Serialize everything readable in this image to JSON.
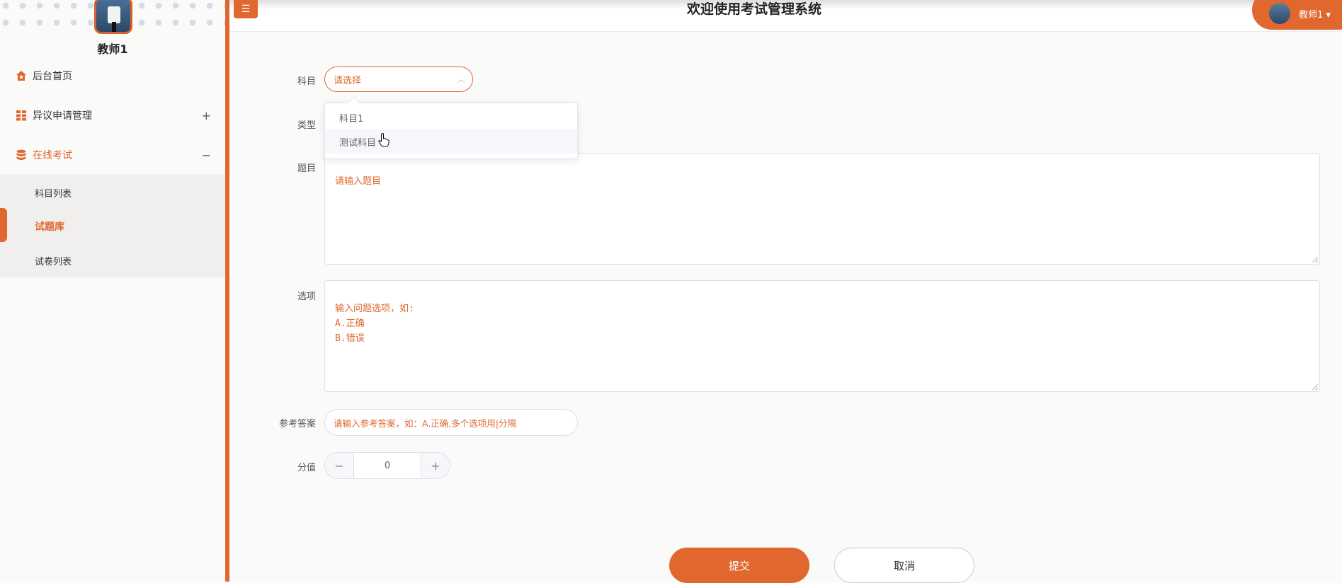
{
  "app": {
    "title": "欢迎使用考试管理系统",
    "user": "教师1",
    "user_menu": "教师1 ▾"
  },
  "sidebar": {
    "username": "教师1",
    "items": [
      {
        "label": "后台首页",
        "icon": "home-icon"
      },
      {
        "label": "异议申请管理",
        "icon": "grid-icon",
        "toggle": "+"
      },
      {
        "label": "在线考试",
        "icon": "database-icon",
        "toggle": "−"
      }
    ],
    "submenu": [
      {
        "label": "科目列表"
      },
      {
        "label": "试题库"
      },
      {
        "label": "试卷列表"
      }
    ]
  },
  "form": {
    "labels": {
      "subject": "科目",
      "type": "类型",
      "question": "题目",
      "options": "选项",
      "answer": "参考答案",
      "score": "分值"
    },
    "subject_placeholder": "请选择",
    "subject_options": [
      "科目1",
      "测试科目"
    ],
    "question_placeholder": "请输入题目",
    "options_placeholder": "输入问题选项，如:\nA.正确\nB.错误",
    "answer_placeholder": "请输入参考答案，如：A.正确,多个选项用|分隔",
    "score_value": "0",
    "stepper_minus": "−",
    "stepper_plus": "+",
    "submit": "提交",
    "cancel": "取消"
  },
  "colors": {
    "accent": "#e0682e"
  }
}
